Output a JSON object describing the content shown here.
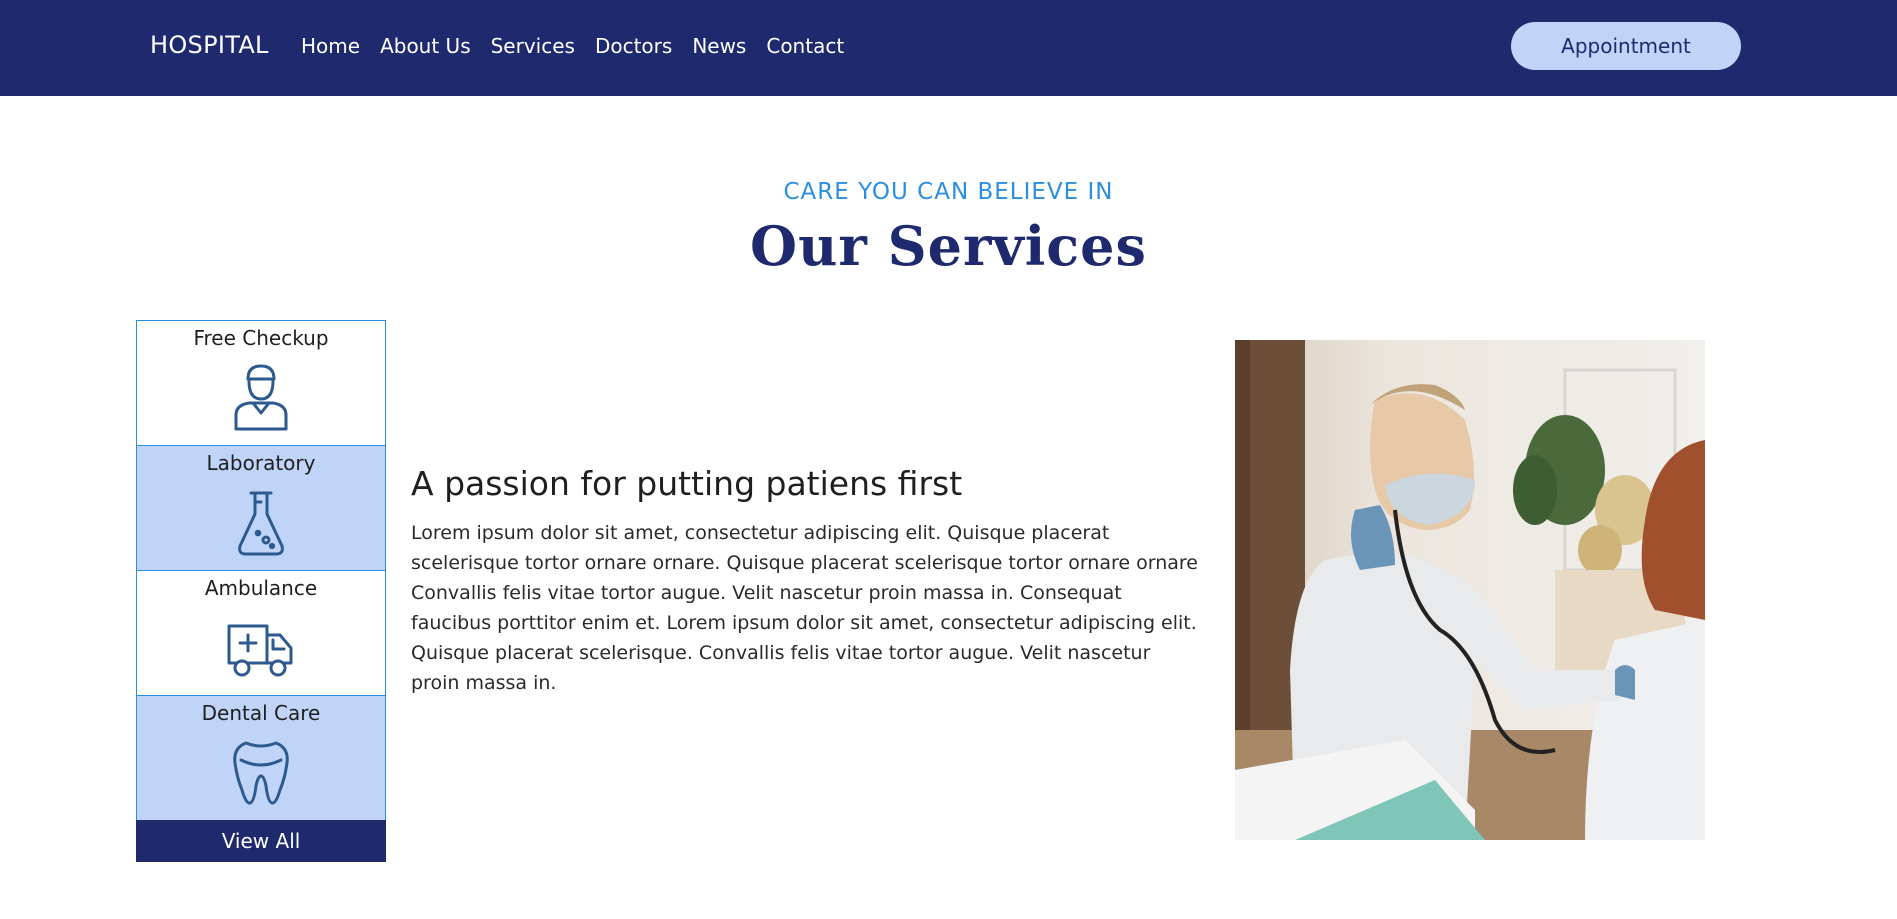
{
  "navbar": {
    "brand": "HOSPITAL",
    "links": [
      "Home",
      "About Us",
      "Services",
      "Doctors",
      "News",
      "Contact"
    ],
    "cta": "Appointment"
  },
  "section": {
    "eyebrow": "CARE YOU CAN BELIEVE IN",
    "title": "Our Services"
  },
  "services": {
    "items": [
      {
        "label": "Free Checkup",
        "icon": "doctor-icon"
      },
      {
        "label": "Laboratory",
        "icon": "flask-icon"
      },
      {
        "label": "Ambulance",
        "icon": "ambulance-icon"
      },
      {
        "label": "Dental Care",
        "icon": "tooth-icon"
      }
    ],
    "view_all": "View All"
  },
  "content": {
    "title": "A passion for putting patiens first",
    "body": "Lorem ipsum dolor sit amet, consectetur adipiscing elit. Quisque placerat scelerisque tortor ornare ornare. Quisque placerat scelerisque tortor ornare ornare Convallis felis vitae tortor augue. Velit nascetur proin massa in. Consequat faucibus porttitor enim et. Lorem ipsum dolor sit amet, consectetur adipiscing elit. Quisque placerat scelerisque. Convallis felis vitae tortor augue. Velit nascetur proin massa in."
  },
  "colors": {
    "navy": "#1f2a6e",
    "accent_blue": "#2b8ee0",
    "light_blue": "#c0d4f7"
  }
}
